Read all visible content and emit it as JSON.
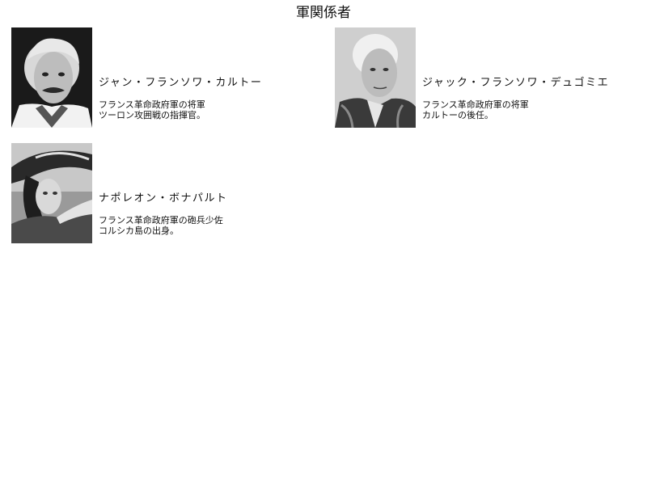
{
  "page": {
    "title": "軍関係者"
  },
  "people": [
    {
      "name": "ジャン・フランソワ・カルトー",
      "desc_line1": "フランス革命政府軍の将軍",
      "desc_line2": "ツーロン攻囲戦の指揮官。"
    },
    {
      "name": "ジャック・フランソワ・デュゴミエ",
      "desc_line1": "フランス革命政府軍の将軍",
      "desc_line2": "カルトーの後任。"
    },
    {
      "name": "ナポレオン・ボナパルト",
      "desc_line1": "フランス革命政府軍の砲兵少佐",
      "desc_line2": "コルシカ島の出身。"
    }
  ]
}
